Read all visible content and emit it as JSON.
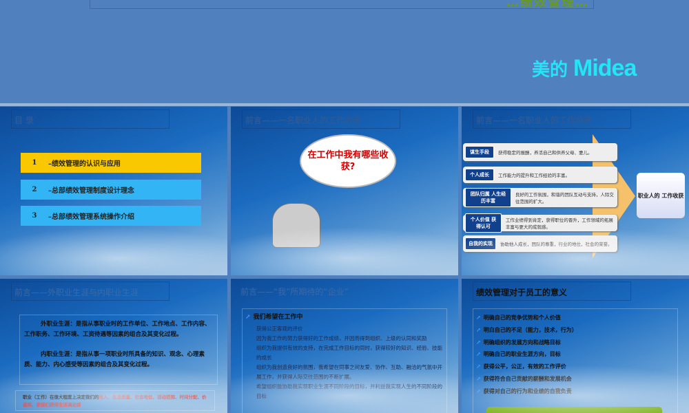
{
  "top_slide": {
    "title_fragment": "…绩效管理…",
    "logo_cn": "美的",
    "logo_en": "Midea"
  },
  "slides": [
    {
      "title": "目  录",
      "items": [
        {
          "num": "1",
          "label": "–绩效管理的认识与应用"
        },
        {
          "num": "2",
          "label": "–总部绩效管理制度设计理念"
        },
        {
          "num": "3",
          "label": "–总部绩效管理系统操作介绍"
        }
      ]
    },
    {
      "title": "前言——一名职业人的工作收获",
      "cloud": "在工作中我有哪些收获?"
    },
    {
      "title": "前言——一名职业人的工作收获",
      "rows": [
        {
          "tag": "谋生手段",
          "text": "获得稳定的报酬，养活自己和供养父母、妻儿。"
        },
        {
          "tag": "个人成长",
          "text": "工作能力的提升和工作经验的丰富。"
        },
        {
          "tag": "团队归属 人生经历丰富",
          "text": "良好的工作氛围，和谐的团队互动与支持，人际交往范围的扩大。"
        },
        {
          "tag": "个人价值 获得认可",
          "text": "工作业绩得到肯定，获得职位的晋升，工作领域的拓展丰富与更大的成就感。"
        },
        {
          "tag": "自我的实现",
          "text": "协助他人成长，团队的尊重，行业的地位，社会的荣誉。"
        }
      ],
      "result": "职业人的 工作收获"
    },
    {
      "title": "前言——外职业生涯与内职业生涯",
      "p1": "外职业生涯：是指从事职业时的工作单位、工作地点、工作内容、工作职务、工作环境、工资待遇等因素的组合及其变化过程。",
      "p2": "内职业生涯：是指从事一项职业时所具备的知识、观念、心理素质、能力、内心感受等因素的组合及其变化过程。",
      "note_prefix": "职业（工作）在很大程度上决定我们的",
      "note_red": "收入、生活质量、社会地位、活动范围、时间分配、价值观、使我们获得生活满足感"
    },
    {
      "title": "前言——“我”所期待的“企业”",
      "head": "我们希望在工作中",
      "subs": [
        "获得公正客观的评价",
        "因为我工作的努力获得好的工作成绩，并因而得到组织、上级的认同和奖励",
        "组织为我提供有效的支持，在完成工作目标的同时，获得较好的知识、经验、技能的成长",
        "组织为我创造良好的氛围，我希望在同事之间友爱、协作、互助、融洽的气氛中开展工作，并获得人际交往范围的不断扩展。",
        "希望组织能协助我实现职业生涯不同阶段的目标，并利益我实现人生的不同阶段的目标"
      ]
    },
    {
      "title": "绩效管理对于员工的意义",
      "items": [
        "明确自己的竞争优势和个人价值",
        "明白自己的不足（能力，技术，行为）",
        "明确组织的发展方向和战略目标",
        "明确自己的职业生涯方向，目标",
        "获得公平，公正，有效的工作评价",
        "获得符合自己贡献的薪酬和发展机会",
        "获得对自己的行为和业绩的自我负责"
      ]
    }
  ]
}
